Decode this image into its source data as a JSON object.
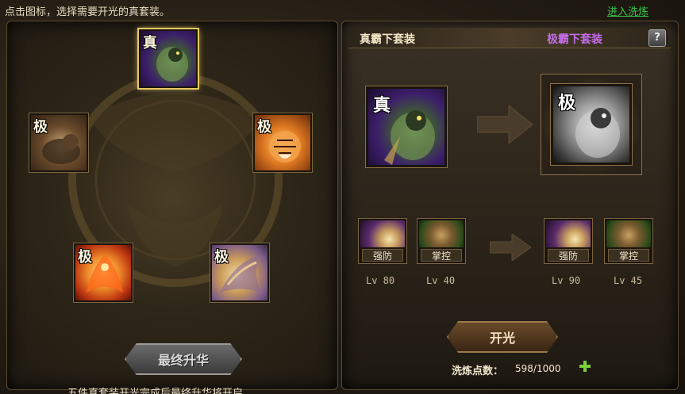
{
  "header": {
    "hint": "点击图标，选择需要开光的真套装。",
    "enter_link": "进入洗炼"
  },
  "left": {
    "slots": [
      {
        "badge": "真",
        "icon": "beast-purple-icon"
      },
      {
        "badge": "极",
        "icon": "beast-icon"
      },
      {
        "badge": "极",
        "icon": "tiger-icon"
      },
      {
        "badge": "极",
        "icon": "phoenix-icon"
      },
      {
        "badge": "极",
        "icon": "dragon-icon"
      }
    ],
    "final_button": "最终升华",
    "note": "五件真套装开光完成后最终升华将开启"
  },
  "right": {
    "set_from": "真霸下套装",
    "set_to": "极霸下套装",
    "help": "?",
    "source_badge": "真",
    "result_badge": "极",
    "skills_before": [
      {
        "name": "强防",
        "level": "Lv 80",
        "icon": "orb-icon"
      },
      {
        "name": "掌控",
        "level": "Lv 40",
        "icon": "horse-icon"
      }
    ],
    "skills_after": [
      {
        "name": "强防",
        "level": "Lv 90",
        "icon": "orb-icon"
      },
      {
        "name": "掌控",
        "level": "Lv 45",
        "icon": "horse-icon"
      }
    ],
    "kai_button": "开光",
    "points_label": "洗炼点数：",
    "points_value": "598/1000"
  },
  "colors": {
    "accent_gold": "#e8c860",
    "purple_text": "#c46de8",
    "link_green": "#36c84a",
    "plus_green": "#7ad03a"
  }
}
